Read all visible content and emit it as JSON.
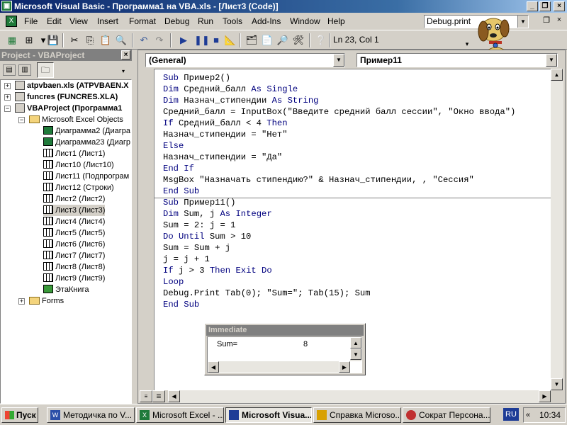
{
  "window": {
    "title": "Microsoft Visual Basic - Программа1 на VBA.xls - [Лист3 (Code)]"
  },
  "menu": [
    {
      "label": "File"
    },
    {
      "label": "Edit"
    },
    {
      "label": "View"
    },
    {
      "label": "Insert"
    },
    {
      "label": "Format"
    },
    {
      "label": "Debug"
    },
    {
      "label": "Run"
    },
    {
      "label": "Tools"
    },
    {
      "label": "Add-Ins"
    },
    {
      "label": "Window"
    },
    {
      "label": "Help"
    }
  ],
  "help_box": {
    "value": "Debug.print"
  },
  "toolbar": {
    "position": "Ln 23, Col 1"
  },
  "project": {
    "title": "Project - VBAProject",
    "nodes": [
      {
        "label": "atpvbaen.xls (ATPVBAEN.X"
      },
      {
        "label": "funcres (FUNCRES.XLA)"
      },
      {
        "label": "VBAProject (Программа1"
      },
      {
        "label": "Microsoft Excel Objects"
      },
      {
        "label": "Диаграмма2 (Диагра"
      },
      {
        "label": "Диаграмма23 (Диагр"
      },
      {
        "label": "Лист1 (Лист1)"
      },
      {
        "label": "Лист10 (Лист10)"
      },
      {
        "label": "Лист11 (Подпрограм"
      },
      {
        "label": "Лист12 (Строки)"
      },
      {
        "label": "Лист2 (Лист2)"
      },
      {
        "label": "Лист3 (Лист3)"
      },
      {
        "label": "Лист4 (Лист4)"
      },
      {
        "label": "Лист5 (Лист5)"
      },
      {
        "label": "Лист6 (Лист6)"
      },
      {
        "label": "Лист7 (Лист7)"
      },
      {
        "label": "Лист8 (Лист8)"
      },
      {
        "label": "Лист9 (Лист9)"
      },
      {
        "label": "ЭтаКнига"
      },
      {
        "label": "Forms"
      }
    ]
  },
  "code": {
    "object_combo": "(General)",
    "proc_combo": "Пример11",
    "lines": [
      "Sub Пример2()",
      "Dim Средний_балл As Single",
      "Dim Назнач_стипендии As String",
      "Средний_балл = InputBox(\"Введите средний балл сессии\", \"Окно ввода\")",
      "If Средний_балл < 4 Then",
      "Назнач_стипендии = \"Нет\"",
      "Else",
      "Назнач_стипендии = \"Да\"",
      "End If",
      "MsgBox \"Назначать стипендию?\" & Назнач_стипендии, , \"Сессия\"",
      "End Sub",
      "Sub Пример11()",
      "Dim Sum, j As Integer",
      "Sum = 2: j = 1",
      "Do Until Sum > 10",
      "Sum = Sum + j",
      "j = j + 1",
      "If j > 3 Then Exit Do",
      "Loop",
      "Debug.Print Tab(0); \"Sum=\"; Tab(15); Sum",
      "End Sub"
    ]
  },
  "immediate": {
    "title": "Immediate",
    "label": "Sum=",
    "value": "8"
  },
  "taskbar": {
    "start": "Пуск",
    "tasks": [
      {
        "label": "Методичка по V..."
      },
      {
        "label": "Microsoft Excel - ..."
      },
      {
        "label": "Microsoft Visua..."
      },
      {
        "label": "Справка Microso..."
      },
      {
        "label": "Сократ Персона..."
      }
    ],
    "lang": "RU",
    "clock": "10:34"
  }
}
